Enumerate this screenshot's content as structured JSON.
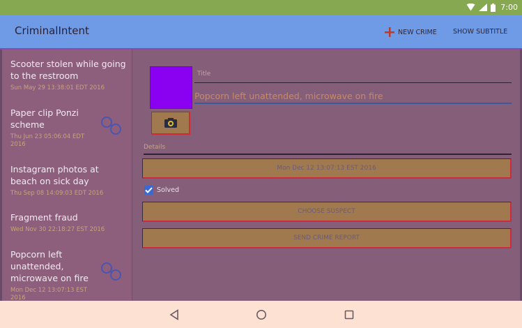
{
  "status_bar": {
    "time": "7:00"
  },
  "app_bar": {
    "title": "CriminalIntent",
    "new_crime_label": "NEW CRIME",
    "show_subtitle_label": "SHOW SUBTITLE"
  },
  "crime_list": [
    {
      "title": "Scooter stolen while going to the restroom",
      "date": "Sun May 29 13:38:01 EDT 2016",
      "suspect_icon": false
    },
    {
      "title": "Paper clip Ponzi scheme",
      "date": "Thu Jun 23 05:06:04 EDT 2016",
      "suspect_icon": true
    },
    {
      "title": "Instagram photos at beach on sick day",
      "date": "Thu Sep 08 14:09:03 EDT 2016",
      "suspect_icon": false
    },
    {
      "title": "Fragment fraud",
      "date": "Wed Nov 30 22:18:27 EST 2016",
      "suspect_icon": false
    },
    {
      "title": "Popcorn left unattended, microwave on fire",
      "date": "Mon Dec 12 13:07:13 EST 2016",
      "suspect_icon": true
    }
  ],
  "detail": {
    "title_label": "Title",
    "title_value": "Popcorn left unattended, microwave on fire",
    "details_label": "Details",
    "date_button": "Mon Dec 12 13:07:13 EST 2016",
    "solved_label": "Solved",
    "solved_checked": true,
    "choose_suspect_button": "CHOOSE SUSPECT",
    "send_report_button": "SEND CRIME REPORT",
    "photo_color": "#8a00f0"
  },
  "nav_bar": {
    "back": "back-icon",
    "home": "home-icon",
    "recents": "recents-icon"
  }
}
